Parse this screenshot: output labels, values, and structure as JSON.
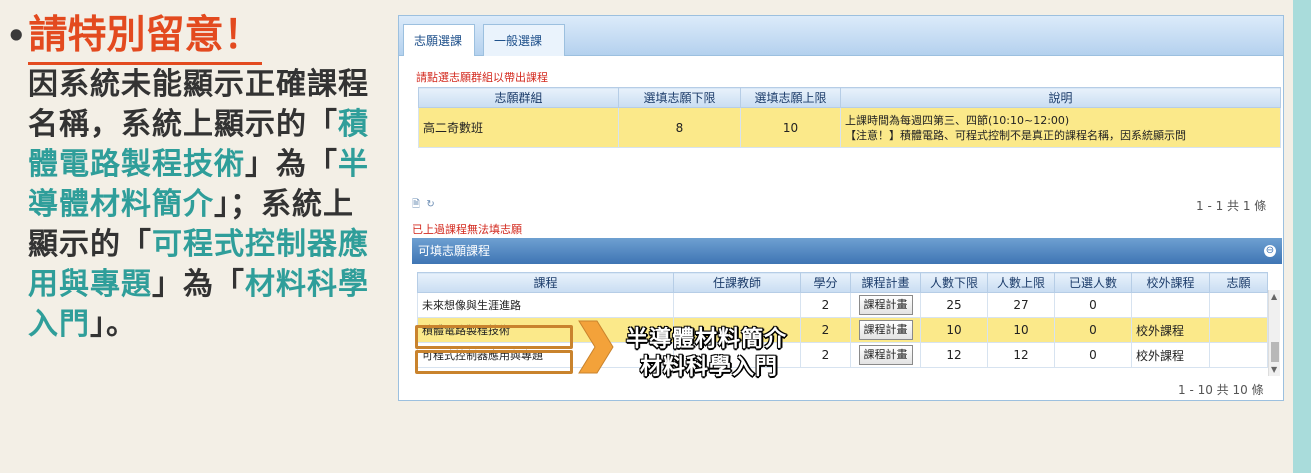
{
  "left": {
    "title": "請特別留意！",
    "para": [
      {
        "text": "因系統未能顯示正確課程名稱，系統上顯示的「",
        "c": "n"
      },
      {
        "text": "積體電路製程技術",
        "c": "t"
      },
      {
        "text": "」為「",
        "c": "n"
      },
      {
        "text": "半導體材料簡介",
        "c": "t"
      },
      {
        "text": "」；系統上顯示的「",
        "c": "n"
      },
      {
        "text": "可程式控制器應用與專題",
        "c": "t"
      },
      {
        "text": "」為「",
        "c": "n"
      },
      {
        "text": "材料科學入門",
        "c": "t"
      },
      {
        "text": "」。",
        "c": "n"
      }
    ]
  },
  "tabs": [
    "志願選課",
    "一般選課"
  ],
  "group_section": {
    "note": "請點選志願群組以帶出課程",
    "headers": [
      "志願群組",
      "選填志願下限",
      "選填志願上限",
      "說明"
    ],
    "row": {
      "group": "高二奇數班",
      "min": "8",
      "max": "10",
      "desc1": "上課時間為每週四第三、四節(10:10~12:00)",
      "desc2": "【注意！】積體電路、可程式控制不是真正的課程名稱，因系統顯示問"
    },
    "pager": "1 - 1 共 1 條",
    "pager_icons": [
      "page-icon",
      "refresh-icon"
    ]
  },
  "warn_note": "已上過課程無法填志願",
  "course_section": {
    "title": "可填志願課程",
    "headers": [
      "課程",
      "任課教師",
      "學分",
      "課程計畫",
      "人數下限",
      "人數上限",
      "已選人數",
      "校外課程",
      "志願"
    ],
    "rows": [
      {
        "course": "未來想像與生涯進路",
        "teacher": "",
        "credit": "2",
        "plan": "課程計畫",
        "min": "25",
        "max": "27",
        "selected": "0",
        "outside": "",
        "wish": "",
        "hl": false
      },
      {
        "course": "積體電路製程技術",
        "teacher": "",
        "credit": "2",
        "plan": "課程計畫",
        "min": "10",
        "max": "10",
        "selected": "0",
        "outside": "校外課程",
        "wish": "",
        "hl": true
      },
      {
        "course": "可程式控制器應用與專題",
        "teacher": "",
        "credit": "2",
        "plan": "課程計畫",
        "min": "12",
        "max": "12",
        "selected": "0",
        "outside": "校外課程",
        "wish": "",
        "hl": false
      }
    ],
    "pager": "1 - 10 共 10 條"
  },
  "overlay": {
    "line1": "半導體材料簡介",
    "line2": "材料科學入門"
  },
  "colors": {
    "accent_red": "#e34a1f",
    "teal": "#2f9e9a",
    "highlight": "#fbe98a",
    "box": "#c9832d"
  }
}
